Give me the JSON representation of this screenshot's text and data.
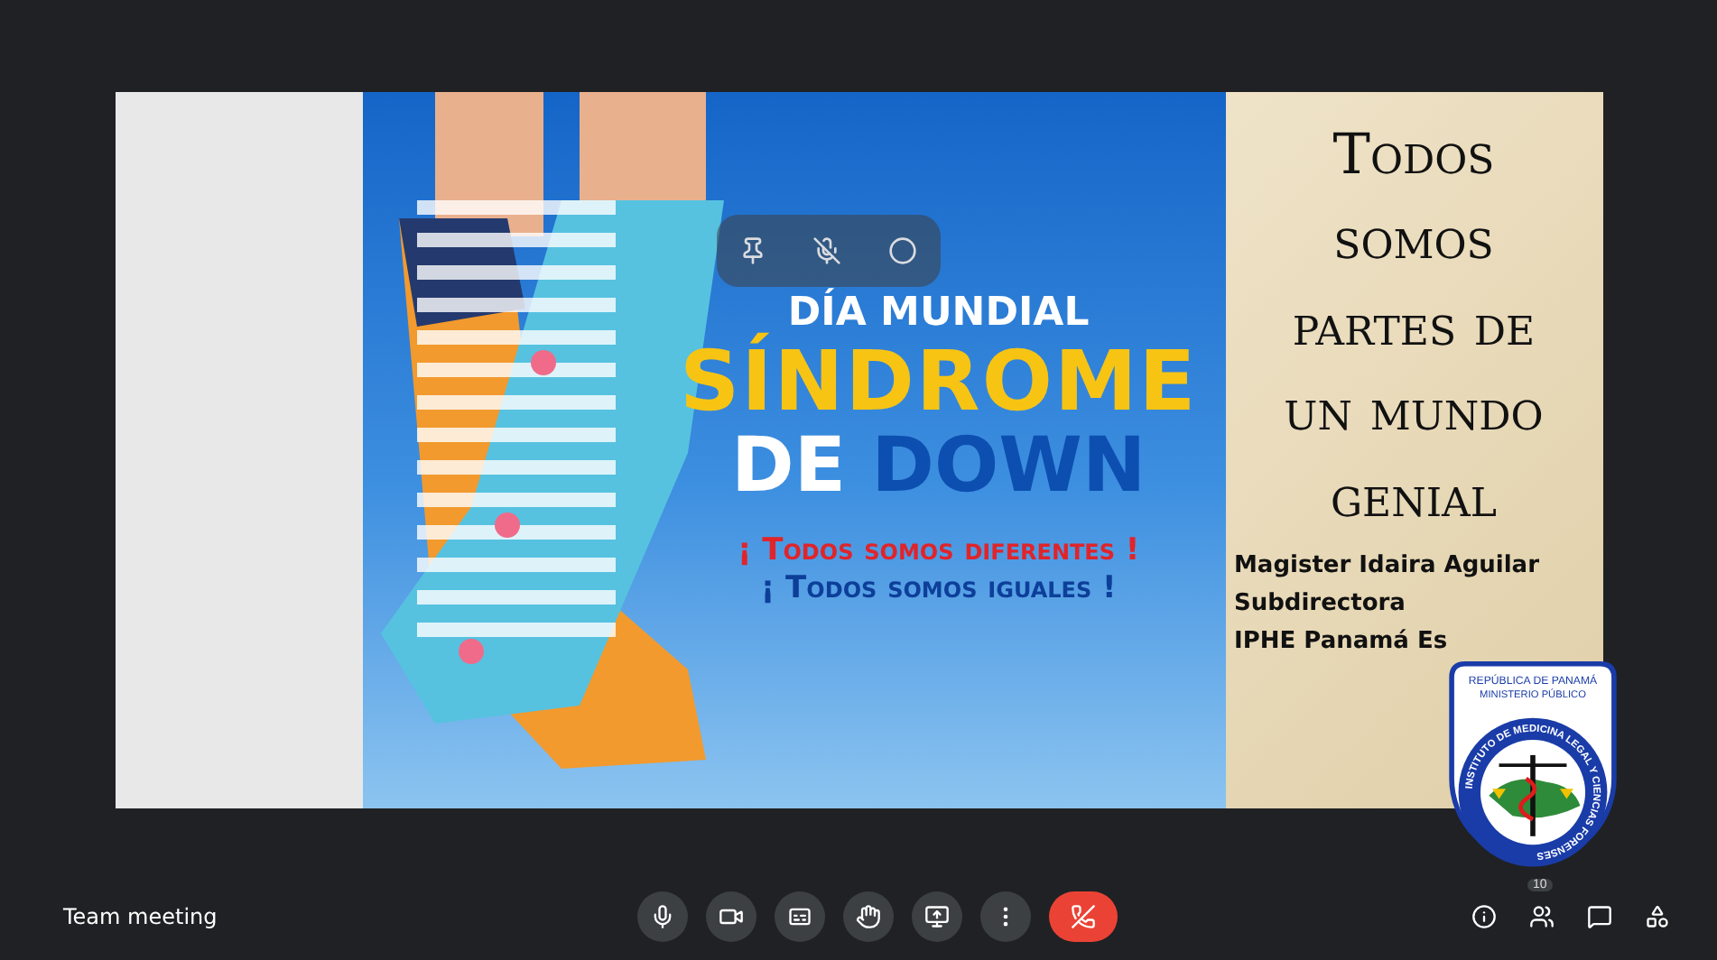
{
  "slide": {
    "poster": {
      "headline_top": "DÍA MUNDIAL",
      "headline_main": "SÍNDROME",
      "headline_sub": [
        "DE",
        "DOWN"
      ],
      "slogans": [
        "¡ Todos somos diferentes !",
        "¡ Todos somos iguales !"
      ]
    },
    "title_lines": [
      "Todos",
      "somos",
      "partes de",
      "un mundo",
      "genial"
    ],
    "credits": [
      "Magister Idaira Aguilar",
      "Subdirectora",
      "IPHE Panamá Es"
    ]
  },
  "logo": {
    "top_lines": [
      "REPÚBLICA DE PANAMÁ",
      "MINISTERIO PÚBLICO"
    ],
    "ring_text": "INSTITUTO DE MEDICINA LEGAL Y CIENCIAS FORENSES"
  },
  "meeting_title": "Team meeting",
  "controls": [
    {
      "kind": "mic"
    },
    {
      "kind": "camera"
    },
    {
      "kind": "captions"
    },
    {
      "kind": "hand"
    },
    {
      "kind": "present"
    },
    {
      "kind": "more"
    },
    {
      "kind": "hangup"
    }
  ],
  "side_controls": [
    {
      "kind": "info"
    },
    {
      "kind": "people",
      "count": "10"
    },
    {
      "kind": "chat"
    },
    {
      "kind": "activities"
    }
  ]
}
